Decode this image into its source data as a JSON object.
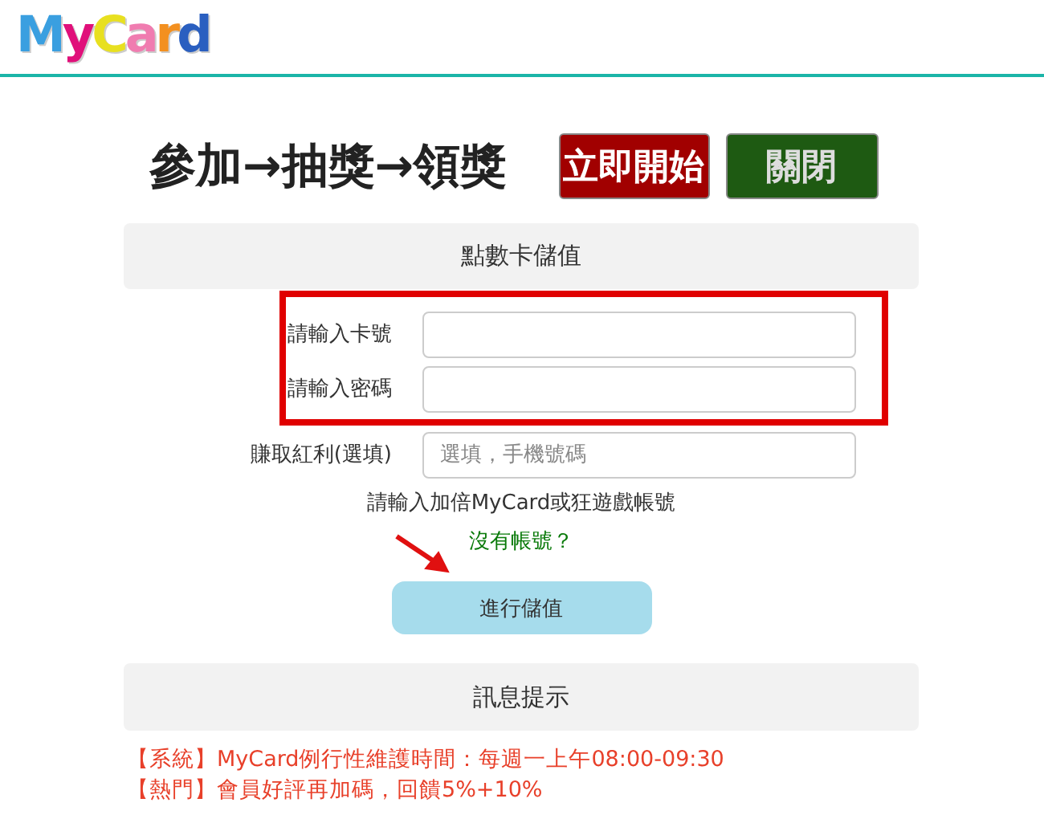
{
  "logo": {
    "letters": [
      {
        "text": "M",
        "color": "#3a9fe0"
      },
      {
        "text": "y",
        "color": "#e0107a"
      },
      {
        "text": "C",
        "color": "#e8e020"
      },
      {
        "text": "a",
        "color": "#f07cb0"
      },
      {
        "text": "r",
        "color": "#f39020"
      },
      {
        "text": "d",
        "color": "#2a5fc0"
      }
    ]
  },
  "promo": {
    "title": "參加→抽獎→領獎",
    "buttons": [
      {
        "label": "立即開始",
        "kind": "start"
      },
      {
        "label": "關閉",
        "kind": "close"
      }
    ]
  },
  "topup": {
    "heading": "點數卡儲值",
    "highlighted_fields": {
      "highlighted": true,
      "fields": [
        {
          "label": "請輸入卡號"
        },
        {
          "label": "請輸入密碼"
        }
      ]
    },
    "fields": [
      {
        "label": "賺取紅利(選填)",
        "placeholder": "選填，手機號碼"
      }
    ],
    "hint": "請輸入加倍MyCard或狂遊戲帳號",
    "link": "沒有帳號？",
    "submit": "進行儲值"
  },
  "messages": {
    "heading": "訊息提示",
    "items": [
      "【系統】MyCard例行性維護時間：每週一上午08:00-09:30",
      "【熱門】會員好評再加碼，回饋5%+10%"
    ]
  }
}
